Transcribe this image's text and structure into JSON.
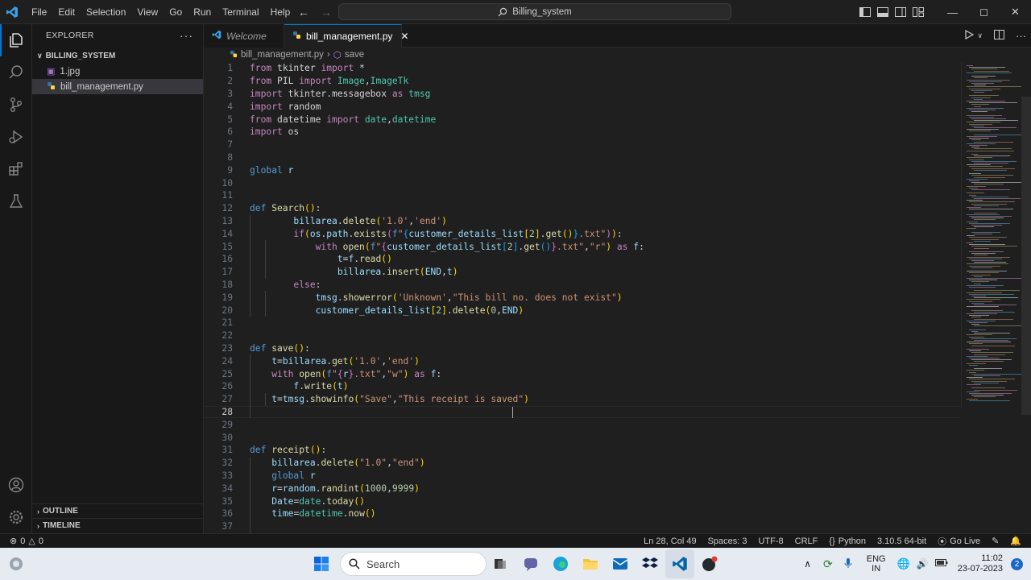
{
  "menu": [
    "File",
    "Edit",
    "Selection",
    "View",
    "Go",
    "Run",
    "Terminal",
    "Help"
  ],
  "command_center": "Billing_system",
  "explorer": {
    "title": "EXPLORER",
    "folder": "BILLING_SYSTEM",
    "files": [
      "1.jpg",
      "bill_management.py"
    ],
    "outline": "OUTLINE",
    "timeline": "TIMELINE"
  },
  "tabs": [
    {
      "label": "Welcome"
    },
    {
      "label": "bill_management.py"
    }
  ],
  "breadcrumb": {
    "file": "bill_management.py",
    "symbol": "save"
  },
  "line_numbers": [
    "1",
    "2",
    "3",
    "4",
    "5",
    "6",
    "7",
    "8",
    "9",
    "10",
    "11",
    "12",
    "13",
    "14",
    "15",
    "16",
    "17",
    "18",
    "19",
    "20",
    "21",
    "22",
    "23",
    "24",
    "25",
    "26",
    "27",
    "28",
    "29",
    "30",
    "31",
    "32",
    "33",
    "34",
    "35",
    "36",
    "37"
  ],
  "code": [
    [
      [
        "kw",
        "from"
      ],
      [
        "tx",
        " tkinter "
      ],
      [
        "kw",
        "import"
      ],
      [
        "tx",
        " *"
      ]
    ],
    [
      [
        "kw",
        "from"
      ],
      [
        "tx",
        " PIL "
      ],
      [
        "kw",
        "import"
      ],
      [
        "cl",
        " Image"
      ],
      [
        "tx",
        ","
      ],
      [
        "cl",
        "ImageTk"
      ]
    ],
    [
      [
        "kw",
        "import"
      ],
      [
        "tx",
        " tkinter.messagebox "
      ],
      [
        "kw",
        "as"
      ],
      [
        "cl",
        " tmsg"
      ]
    ],
    [
      [
        "kw",
        "import"
      ],
      [
        "tx",
        " random"
      ]
    ],
    [
      [
        "kw",
        "from"
      ],
      [
        "tx",
        " datetime "
      ],
      [
        "kw",
        "import"
      ],
      [
        "cl",
        " date"
      ],
      [
        "tx",
        ","
      ],
      [
        "cl",
        "datetime"
      ]
    ],
    [
      [
        "kw",
        "import"
      ],
      [
        "tx",
        " os"
      ]
    ],
    [],
    [],
    [
      [
        "k2",
        "global"
      ],
      [
        "va",
        " r"
      ]
    ],
    [],
    [],
    [
      [
        "k2",
        "def"
      ],
      [
        "fn",
        " Search"
      ],
      [
        "br",
        "()"
      ],
      [
        "tx",
        ":"
      ]
    ],
    [
      [
        "tx",
        "        "
      ],
      [
        "va",
        "billarea"
      ],
      [
        "tx",
        "."
      ],
      [
        "fn",
        "delete"
      ],
      [
        "br",
        "("
      ],
      [
        "st",
        "'1.0'"
      ],
      [
        "tx",
        ","
      ],
      [
        "st",
        "'end'"
      ],
      [
        "br",
        ")"
      ]
    ],
    [
      [
        "tx",
        "        "
      ],
      [
        "kw",
        "if"
      ],
      [
        "br",
        "("
      ],
      [
        "va",
        "os"
      ],
      [
        "tx",
        "."
      ],
      [
        "va",
        "path"
      ],
      [
        "tx",
        "."
      ],
      [
        "fn",
        "exists"
      ],
      [
        "br2",
        "("
      ],
      [
        "k2",
        "f"
      ],
      [
        "st",
        "\""
      ],
      [
        "br3",
        "{"
      ],
      [
        "va",
        "customer_details_list"
      ],
      [
        "br",
        "["
      ],
      [
        "nm",
        "2"
      ],
      [
        "br",
        "]"
      ],
      [
        "tx",
        "."
      ],
      [
        "fn",
        "get"
      ],
      [
        "br",
        "()"
      ],
      [
        "br3",
        "}"
      ],
      [
        "st",
        ".txt\""
      ],
      [
        "br2",
        ")"
      ],
      [
        "br",
        ")"
      ],
      [
        "tx",
        ":"
      ]
    ],
    [
      [
        "tx",
        "            "
      ],
      [
        "kw",
        "with"
      ],
      [
        "fn",
        " open"
      ],
      [
        "br",
        "("
      ],
      [
        "k2",
        "f"
      ],
      [
        "st",
        "\""
      ],
      [
        "br2",
        "{"
      ],
      [
        "va",
        "customer_details_list"
      ],
      [
        "br3",
        "["
      ],
      [
        "nm",
        "2"
      ],
      [
        "br3",
        "]"
      ],
      [
        "tx",
        "."
      ],
      [
        "fn",
        "get"
      ],
      [
        "br3",
        "()"
      ],
      [
        "br2",
        "}"
      ],
      [
        "st",
        ".txt\""
      ],
      [
        "tx",
        ","
      ],
      [
        "st",
        "\"r\""
      ],
      [
        "br",
        ")"
      ],
      [
        "kw",
        " as"
      ],
      [
        "va",
        " f"
      ],
      [
        "tx",
        ":"
      ]
    ],
    [
      [
        "tx",
        "                "
      ],
      [
        "va",
        "t"
      ],
      [
        "tx",
        "="
      ],
      [
        "va",
        "f"
      ],
      [
        "tx",
        "."
      ],
      [
        "fn",
        "read"
      ],
      [
        "br",
        "()"
      ]
    ],
    [
      [
        "tx",
        "                "
      ],
      [
        "va",
        "billarea"
      ],
      [
        "tx",
        "."
      ],
      [
        "fn",
        "insert"
      ],
      [
        "br",
        "("
      ],
      [
        "va",
        "END"
      ],
      [
        "tx",
        ","
      ],
      [
        "va",
        "t"
      ],
      [
        "br",
        ")"
      ]
    ],
    [
      [
        "tx",
        "        "
      ],
      [
        "kw",
        "else"
      ],
      [
        "tx",
        ":"
      ]
    ],
    [
      [
        "tx",
        "            "
      ],
      [
        "va",
        "tmsg"
      ],
      [
        "tx",
        "."
      ],
      [
        "fn",
        "showerror"
      ],
      [
        "br",
        "("
      ],
      [
        "st",
        "'Unknown'"
      ],
      [
        "tx",
        ","
      ],
      [
        "st",
        "\"This bill no. does not exist\""
      ],
      [
        "br",
        ")"
      ]
    ],
    [
      [
        "tx",
        "            "
      ],
      [
        "va",
        "customer_details_list"
      ],
      [
        "br",
        "["
      ],
      [
        "nm",
        "2"
      ],
      [
        "br",
        "]"
      ],
      [
        "tx",
        "."
      ],
      [
        "fn",
        "delete"
      ],
      [
        "br",
        "("
      ],
      [
        "nm",
        "0"
      ],
      [
        "tx",
        ","
      ],
      [
        "va",
        "END"
      ],
      [
        "br",
        ")"
      ]
    ],
    [],
    [],
    [
      [
        "k2",
        "def"
      ],
      [
        "fn",
        " save"
      ],
      [
        "br",
        "()"
      ],
      [
        "tx",
        ":"
      ]
    ],
    [
      [
        "tx",
        "    "
      ],
      [
        "va",
        "t"
      ],
      [
        "tx",
        "="
      ],
      [
        "va",
        "billarea"
      ],
      [
        "tx",
        "."
      ],
      [
        "fn",
        "get"
      ],
      [
        "br",
        "("
      ],
      [
        "st",
        "'1.0'"
      ],
      [
        "tx",
        ","
      ],
      [
        "st",
        "'end'"
      ],
      [
        "br",
        ")"
      ]
    ],
    [
      [
        "tx",
        "    "
      ],
      [
        "kw",
        "with"
      ],
      [
        "fn",
        " open"
      ],
      [
        "br",
        "("
      ],
      [
        "k2",
        "f"
      ],
      [
        "st",
        "\""
      ],
      [
        "br2",
        "{"
      ],
      [
        "va",
        "r"
      ],
      [
        "br2",
        "}"
      ],
      [
        "st",
        ".txt\""
      ],
      [
        "tx",
        ","
      ],
      [
        "st",
        "\"w\""
      ],
      [
        "br",
        ")"
      ],
      [
        "kw",
        " as"
      ],
      [
        "va",
        " f"
      ],
      [
        "tx",
        ":"
      ]
    ],
    [
      [
        "tx",
        "        "
      ],
      [
        "va",
        "f"
      ],
      [
        "tx",
        "."
      ],
      [
        "fn",
        "write"
      ],
      [
        "br",
        "("
      ],
      [
        "va",
        "t"
      ],
      [
        "br",
        ")"
      ]
    ],
    [
      [
        "tx",
        "    "
      ],
      [
        "va",
        "t"
      ],
      [
        "tx",
        "="
      ],
      [
        "va",
        "tmsg"
      ],
      [
        "tx",
        "."
      ],
      [
        "fn",
        "showinfo"
      ],
      [
        "br",
        "("
      ],
      [
        "st",
        "\"Save\""
      ],
      [
        "tx",
        ","
      ],
      [
        "st",
        "\"This receipt is saved\""
      ],
      [
        "br",
        ")"
      ]
    ],
    [],
    [],
    [],
    [
      [
        "k2",
        "def"
      ],
      [
        "fn",
        " receipt"
      ],
      [
        "br",
        "()"
      ],
      [
        "tx",
        ":"
      ]
    ],
    [
      [
        "tx",
        "    "
      ],
      [
        "va",
        "billarea"
      ],
      [
        "tx",
        "."
      ],
      [
        "fn",
        "delete"
      ],
      [
        "br",
        "("
      ],
      [
        "st",
        "\"1.0\""
      ],
      [
        "tx",
        ","
      ],
      [
        "st",
        "\"end\""
      ],
      [
        "br",
        ")"
      ]
    ],
    [
      [
        "tx",
        "    "
      ],
      [
        "k2",
        "global"
      ],
      [
        "va",
        " r"
      ]
    ],
    [
      [
        "tx",
        "    "
      ],
      [
        "va",
        "r"
      ],
      [
        "tx",
        "="
      ],
      [
        "va",
        "random"
      ],
      [
        "tx",
        "."
      ],
      [
        "fn",
        "randint"
      ],
      [
        "br",
        "("
      ],
      [
        "nm",
        "1000"
      ],
      [
        "tx",
        ","
      ],
      [
        "nm",
        "9999"
      ],
      [
        "br",
        ")"
      ]
    ],
    [
      [
        "tx",
        "    "
      ],
      [
        "va",
        "Date"
      ],
      [
        "tx",
        "="
      ],
      [
        "cl",
        "date"
      ],
      [
        "tx",
        "."
      ],
      [
        "fn",
        "today"
      ],
      [
        "br",
        "()"
      ]
    ],
    [
      [
        "tx",
        "    "
      ],
      [
        "va",
        "time"
      ],
      [
        "tx",
        "="
      ],
      [
        "cl",
        "datetime"
      ],
      [
        "tx",
        "."
      ],
      [
        "fn",
        "now"
      ],
      [
        "br",
        "()"
      ]
    ],
    []
  ],
  "status": {
    "errors": "0",
    "warnings": "0",
    "position": "Ln 28, Col 49",
    "spaces": "Spaces: 3",
    "encoding": "UTF-8",
    "eol": "CRLF",
    "language": "Python",
    "interpreter": "3.10.5 64-bit",
    "golive": "Go Live"
  },
  "taskbar": {
    "search": "Search",
    "lang": "ENG",
    "region": "IN",
    "time": "11:02",
    "date": "23-07-2023",
    "notif": "2"
  },
  "colors": {
    "accent": "#0078d4",
    "editor_bg": "#1f1f1f",
    "sidebar_bg": "#181818",
    "keyword": "#c586c0",
    "function": "#dcdcaa",
    "string": "#ce9178"
  }
}
